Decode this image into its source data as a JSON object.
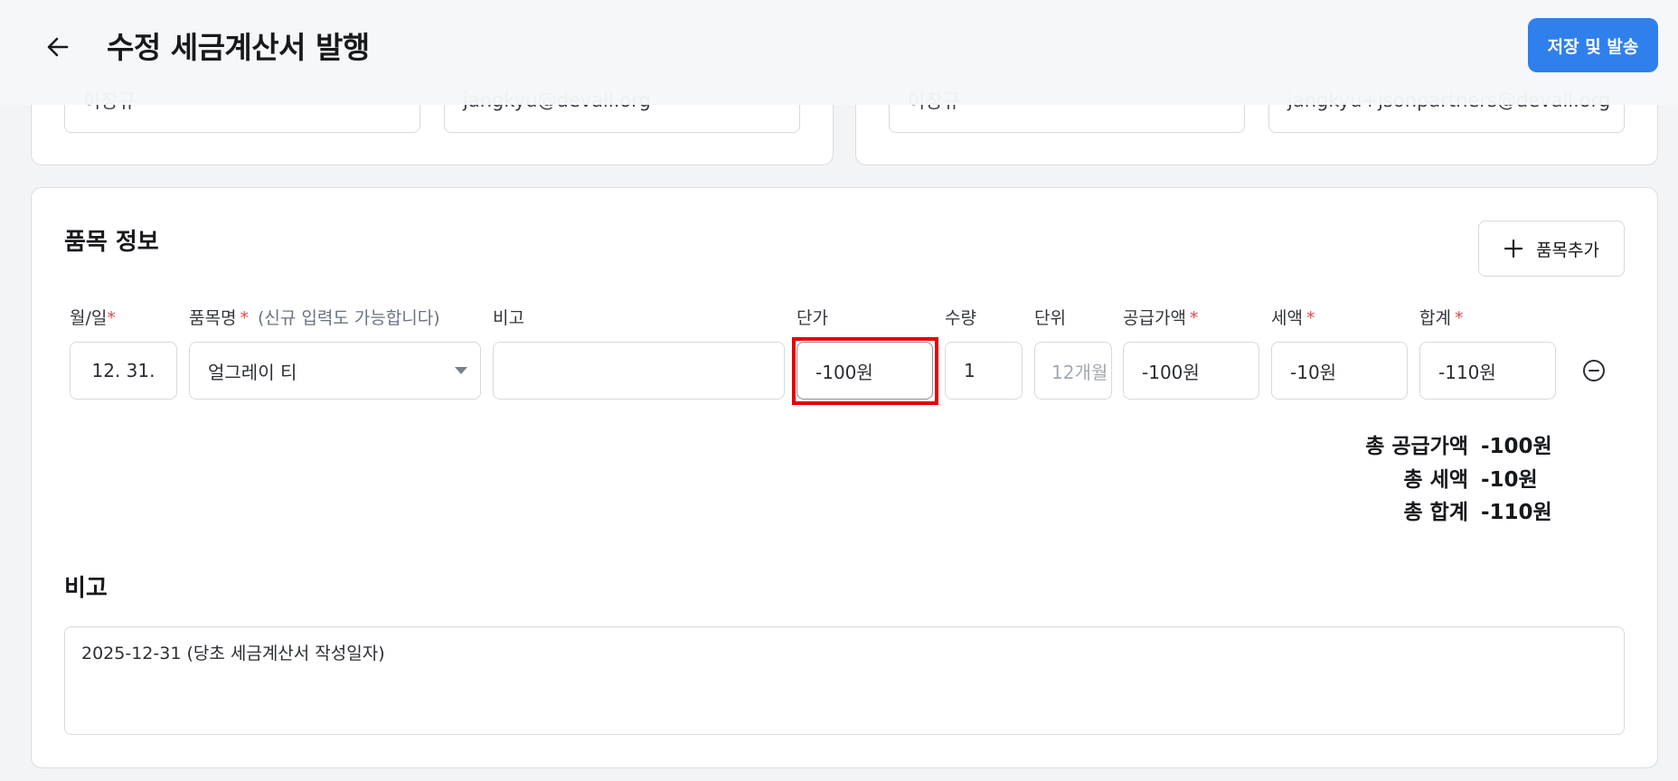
{
  "header": {
    "title": "수정 세금계산서 발행",
    "save_send_label": "저장 및 발송"
  },
  "supplier_contact": {
    "name_value": "이장규",
    "email_value": "jangkyu@devall.org"
  },
  "buyer_contact": {
    "name_value": "이장규",
    "email_value": "jangkyu+jsonpartners@devall.org"
  },
  "items": {
    "section_title": "품목 정보",
    "add_item_label": "품목추가",
    "columns": {
      "date": "월/일",
      "item_name": "품목명",
      "item_name_hint": "(신규 입력도 가능합니다)",
      "note": "비고",
      "unit_price": "단가",
      "quantity": "수량",
      "unit": "단위",
      "supply_amount": "공급가액",
      "tax": "세액",
      "total": "합계",
      "required_mark": "*"
    },
    "rows": [
      {
        "date": "12. 31.",
        "item_name": "얼그레이 티",
        "note": "",
        "unit_price": "-100원",
        "quantity": "1",
        "unit_placeholder": "12개월",
        "supply_amount": "-100원",
        "tax": "-10원",
        "total": "-110원"
      }
    ],
    "totals": {
      "supply_label": "총 공급가액",
      "supply_value": "-100원",
      "tax_label": "총 세액",
      "tax_value": "-10원",
      "grand_label": "총 합계",
      "grand_value": "-110원"
    }
  },
  "memo": {
    "title": "비고",
    "value": "2025-12-31 (당초 세금계산서 작성일자)"
  },
  "colors": {
    "primary": "#2f80ed",
    "required": "#e5484d",
    "highlight": "#e60000"
  }
}
